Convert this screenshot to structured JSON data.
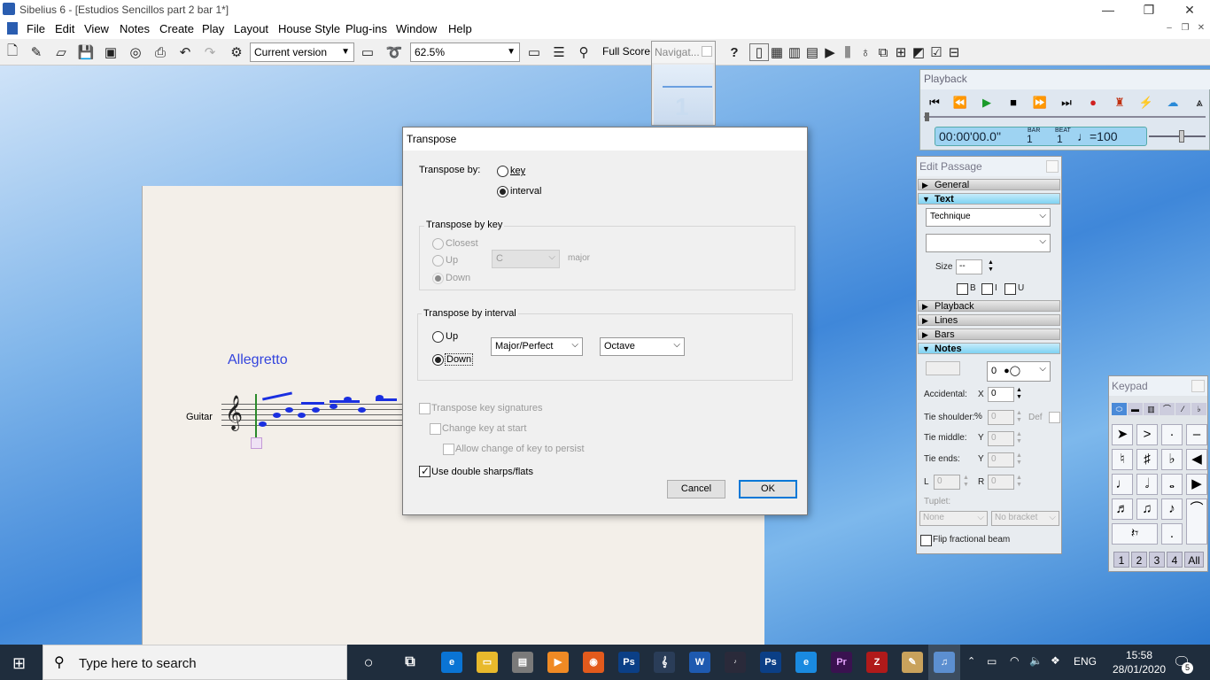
{
  "app": {
    "title": "Sibelius 6 - [Estudios Sencillos part 2 bar 1*]"
  },
  "menu": [
    "File",
    "Edit",
    "View",
    "Notes",
    "Create",
    "Play",
    "Layout",
    "House Style",
    "Plug-ins",
    "Window",
    "Help"
  ],
  "toolbar": {
    "version": "Current version",
    "zoom": "62.5%",
    "view": "Full Score",
    "help": "?"
  },
  "navigator": {
    "title": "Navigat...",
    "page": "1"
  },
  "score": {
    "tempo": "Allegretto",
    "instrument": "Guitar"
  },
  "dialog": {
    "title": "Transpose",
    "transpose_by_label": "Transpose by:",
    "key_option": "key",
    "interval_option": "interval",
    "by_key_group": "Transpose by key",
    "closest": "Closest",
    "up_key": "Up",
    "down_key": "Down",
    "key_value": "C",
    "key_mode": "major",
    "by_interval_group": "Transpose by interval",
    "up_interval": "Up",
    "down_interval": "Down",
    "interval_quality": "Major/Perfect",
    "interval_size": "Octave",
    "transpose_key_sigs": "Transpose key signatures",
    "change_key_at_start": "Change key at start",
    "allow_change_persist": "Allow change of key to persist",
    "double_sharps": "Use double sharps/flats",
    "cancel": "Cancel",
    "ok": "OK"
  },
  "playback": {
    "title": "Playback",
    "time": "00:00'00.0\"",
    "bar_label": "BAR",
    "bar": "1",
    "beat_label": "BEAT",
    "beat": "1",
    "tempo": "♩=100"
  },
  "edit_passage": {
    "title": "Edit Passage",
    "sections": {
      "general": "General",
      "text": "Text",
      "playback": "Playback",
      "lines": "Lines",
      "bars": "Bars",
      "notes": "Notes"
    },
    "text_style": "Technique",
    "size_label": "Size",
    "size_value": "--",
    "bold": "B",
    "italic": "I",
    "underline": "U",
    "notehead": "0",
    "accidental_label": "Accidental:",
    "accidental_x_label": "X",
    "accidental_x": "0",
    "tie_shoulder_label": "Tie shoulder:",
    "tie_shoulder_unit": "%",
    "tie_shoulder": "0",
    "def_label": "Def",
    "tie_middle_label": "Tie middle:",
    "tie_middle_y_label": "Y",
    "tie_middle": "0",
    "tie_ends_label": "Tie ends:",
    "tie_ends_y_label": "Y",
    "tie_ends": "0",
    "l_label": "L",
    "l_value": "0",
    "r_label": "R",
    "r_value": "0",
    "tuplet_label": "Tuplet:",
    "tuplet_value": "None",
    "bracket_value": "No bracket",
    "flip_beam": "Flip fractional beam"
  },
  "keypad": {
    "title": "Keypad",
    "layouts": [
      "1",
      "2",
      "3",
      "4",
      "All"
    ]
  },
  "taskbar": {
    "search_placeholder": "Type here to search",
    "lang": "ENG",
    "time": "15:58",
    "date": "28/01/2020",
    "notif_count": "5"
  }
}
